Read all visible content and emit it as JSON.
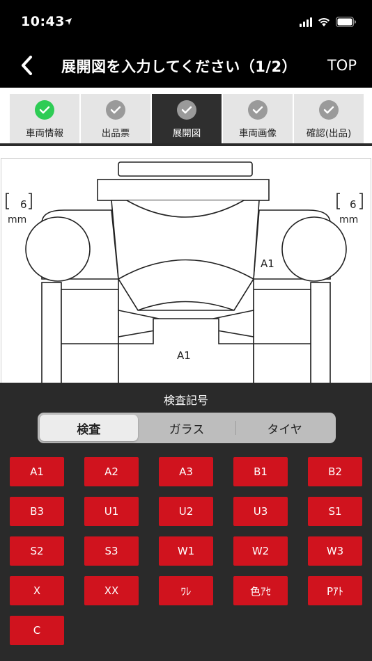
{
  "status_bar": {
    "time": "10:43"
  },
  "nav": {
    "title": "展開図を入力してください（1/2）",
    "top_label": "TOP"
  },
  "steps": [
    {
      "label": "車両情報",
      "state": "done"
    },
    {
      "label": "出品票",
      "state": "pending"
    },
    {
      "label": "展開図",
      "state": "active"
    },
    {
      "label": "車両画像",
      "state": "pending"
    },
    {
      "label": "確認(出品)",
      "state": "pending"
    }
  ],
  "diagram": {
    "left_tire_depth": "6",
    "right_tire_depth": "6",
    "unit": "mm",
    "marks": [
      "A1",
      "A1"
    ]
  },
  "panel": {
    "title": "検査記号",
    "segments": [
      "検査",
      "ガラス",
      "タイヤ"
    ],
    "selected_segment": "検査",
    "codes": [
      "A1",
      "A2",
      "A3",
      "B1",
      "B2",
      "B3",
      "U1",
      "U2",
      "U3",
      "S1",
      "S2",
      "S3",
      "W1",
      "W2",
      "W3",
      "X",
      "XX",
      "ﾜﾚ",
      "色ｱｾ",
      "Pｱﾄ",
      "C"
    ]
  },
  "colors": {
    "accent_red": "#d0131e",
    "done_green": "#2ecc55"
  }
}
